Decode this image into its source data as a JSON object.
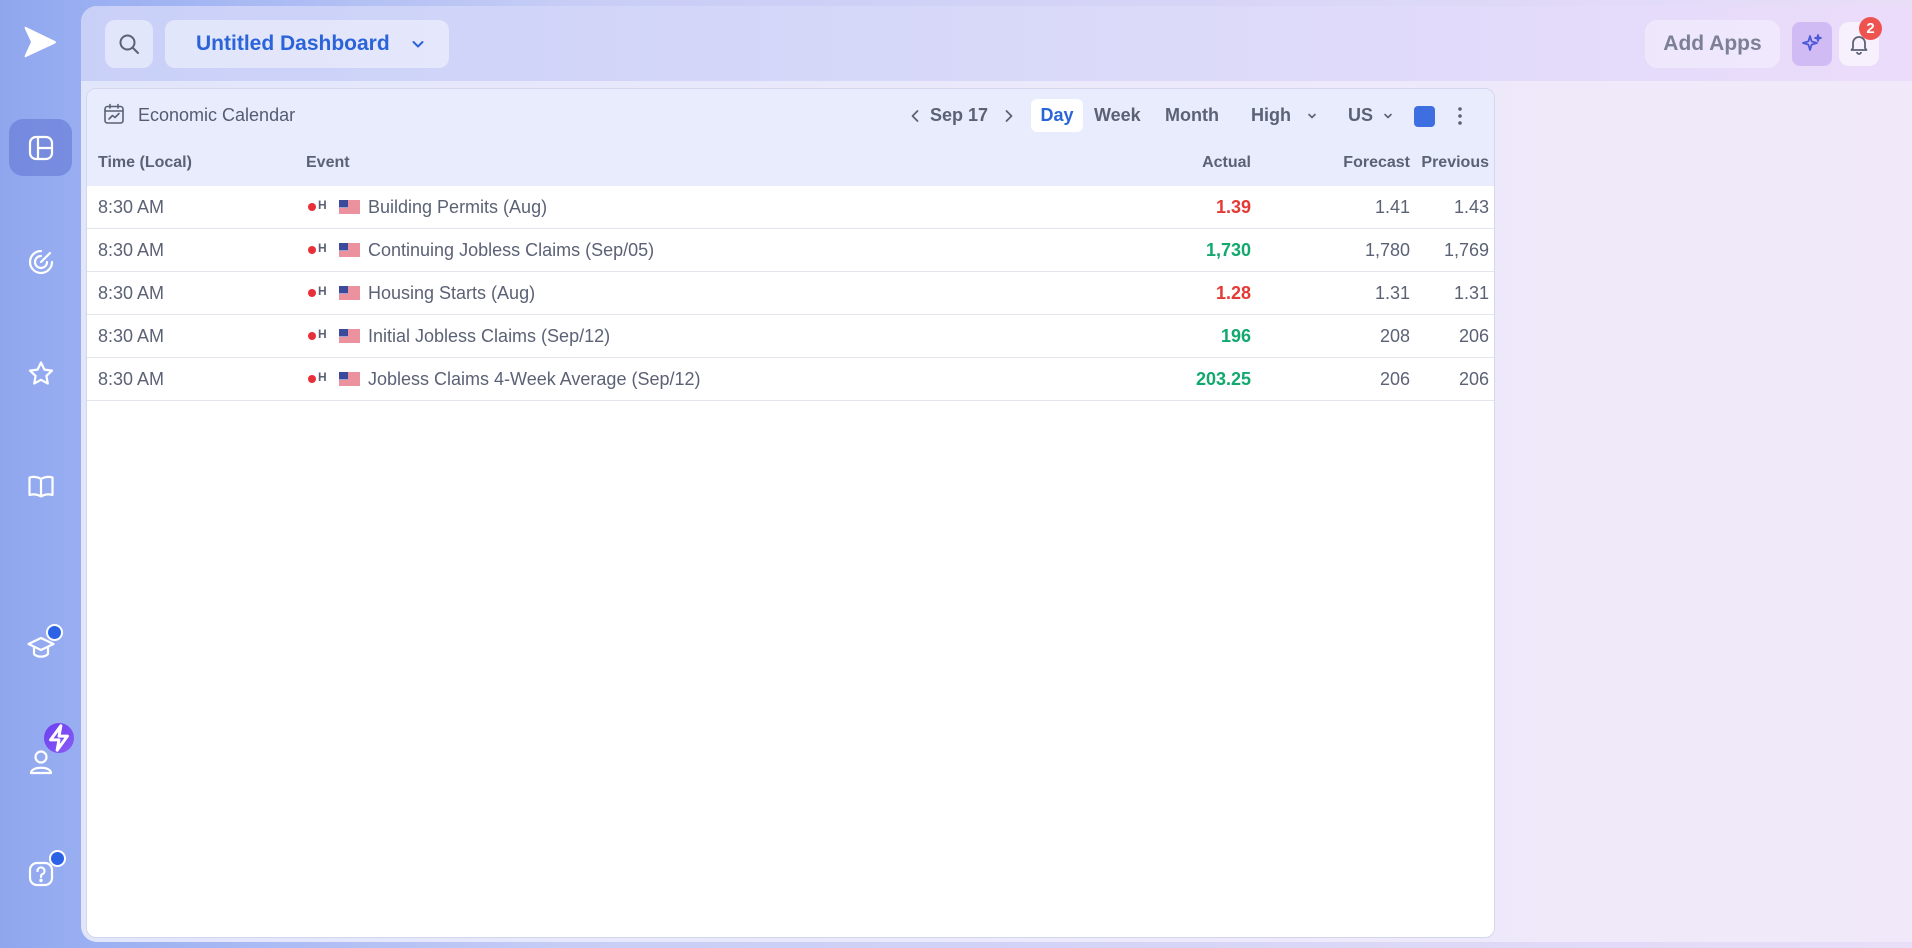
{
  "header": {
    "dashboard_title": "Untitled Dashboard",
    "add_apps_label": "Add Apps",
    "notification_count": "2"
  },
  "sidebar": {
    "items": [
      {
        "name": "dashboard",
        "icon": "dashboard-icon",
        "active": true
      },
      {
        "name": "radar",
        "icon": "radar-icon"
      },
      {
        "name": "favorites",
        "icon": "star-icon"
      },
      {
        "name": "library",
        "icon": "book-icon"
      },
      {
        "name": "learn",
        "icon": "graduation-cap-icon"
      },
      {
        "name": "profile",
        "icon": "user-icon"
      },
      {
        "name": "help",
        "icon": "help-icon"
      }
    ]
  },
  "widget": {
    "title": "Economic Calendar",
    "date": "Sep 17",
    "views": [
      "Day",
      "Week",
      "Month"
    ],
    "active_view": "Day",
    "importance": "High",
    "country": "US",
    "accent_color": "#3e6fe0",
    "columns": {
      "time": "Time (Local)",
      "event": "Event",
      "actual": "Actual",
      "forecast": "Forecast",
      "previous": "Previous"
    },
    "rows": [
      {
        "time": "8:30 AM",
        "importance": "H",
        "event": "Building Permits (Aug)",
        "actual": "1.39",
        "actual_color": "#e53935",
        "forecast": "1.41",
        "previous": "1.43"
      },
      {
        "time": "8:30 AM",
        "importance": "H",
        "event": "Continuing Jobless Claims (Sep/05)",
        "actual": "1,730",
        "actual_color": "#12a86e",
        "forecast": "1,780",
        "previous": "1,769"
      },
      {
        "time": "8:30 AM",
        "importance": "H",
        "event": "Housing Starts (Aug)",
        "actual": "1.28",
        "actual_color": "#e53935",
        "forecast": "1.31",
        "previous": "1.31"
      },
      {
        "time": "8:30 AM",
        "importance": "H",
        "event": "Initial Jobless Claims (Sep/12)",
        "actual": "196",
        "actual_color": "#12a86e",
        "forecast": "208",
        "previous": "206"
      },
      {
        "time": "8:30 AM",
        "importance": "H",
        "event": "Jobless Claims 4-Week Average (Sep/12)",
        "actual": "203.25",
        "actual_color": "#12a86e",
        "forecast": "206",
        "previous": "206"
      }
    ]
  }
}
